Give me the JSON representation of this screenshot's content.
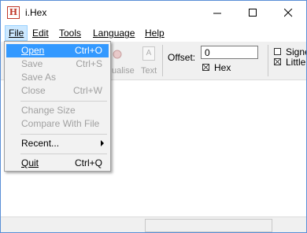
{
  "window": {
    "title": "i.Hex",
    "app_icon": "H"
  },
  "menubar": {
    "items": [
      "File",
      "Edit",
      "Tools",
      "Language",
      "Help"
    ]
  },
  "toolbar": {
    "visualise_label": "ualise",
    "text_label": "Text",
    "text_glyph": "A",
    "offset_label": "Offset:",
    "offset_value": "0",
    "hex_label": "Hex",
    "signed_label": "Signe",
    "little_label": "Little"
  },
  "file_menu": {
    "open": {
      "label": "Open",
      "shortcut": "Ctrl+O"
    },
    "save": {
      "label": "Save",
      "shortcut": "Ctrl+S"
    },
    "save_as": {
      "label": "Save As"
    },
    "close": {
      "label": "Close",
      "shortcut": "Ctrl+W"
    },
    "change_size": {
      "label": "Change Size"
    },
    "compare": {
      "label": "Compare With File"
    },
    "recent": {
      "label": "Recent..."
    },
    "quit": {
      "label": "Quit",
      "shortcut": "Ctrl+Q"
    }
  },
  "colors": {
    "highlight": "#3399ff",
    "menu_active": "#cce8ff",
    "icon_red": "#c0392b"
  }
}
